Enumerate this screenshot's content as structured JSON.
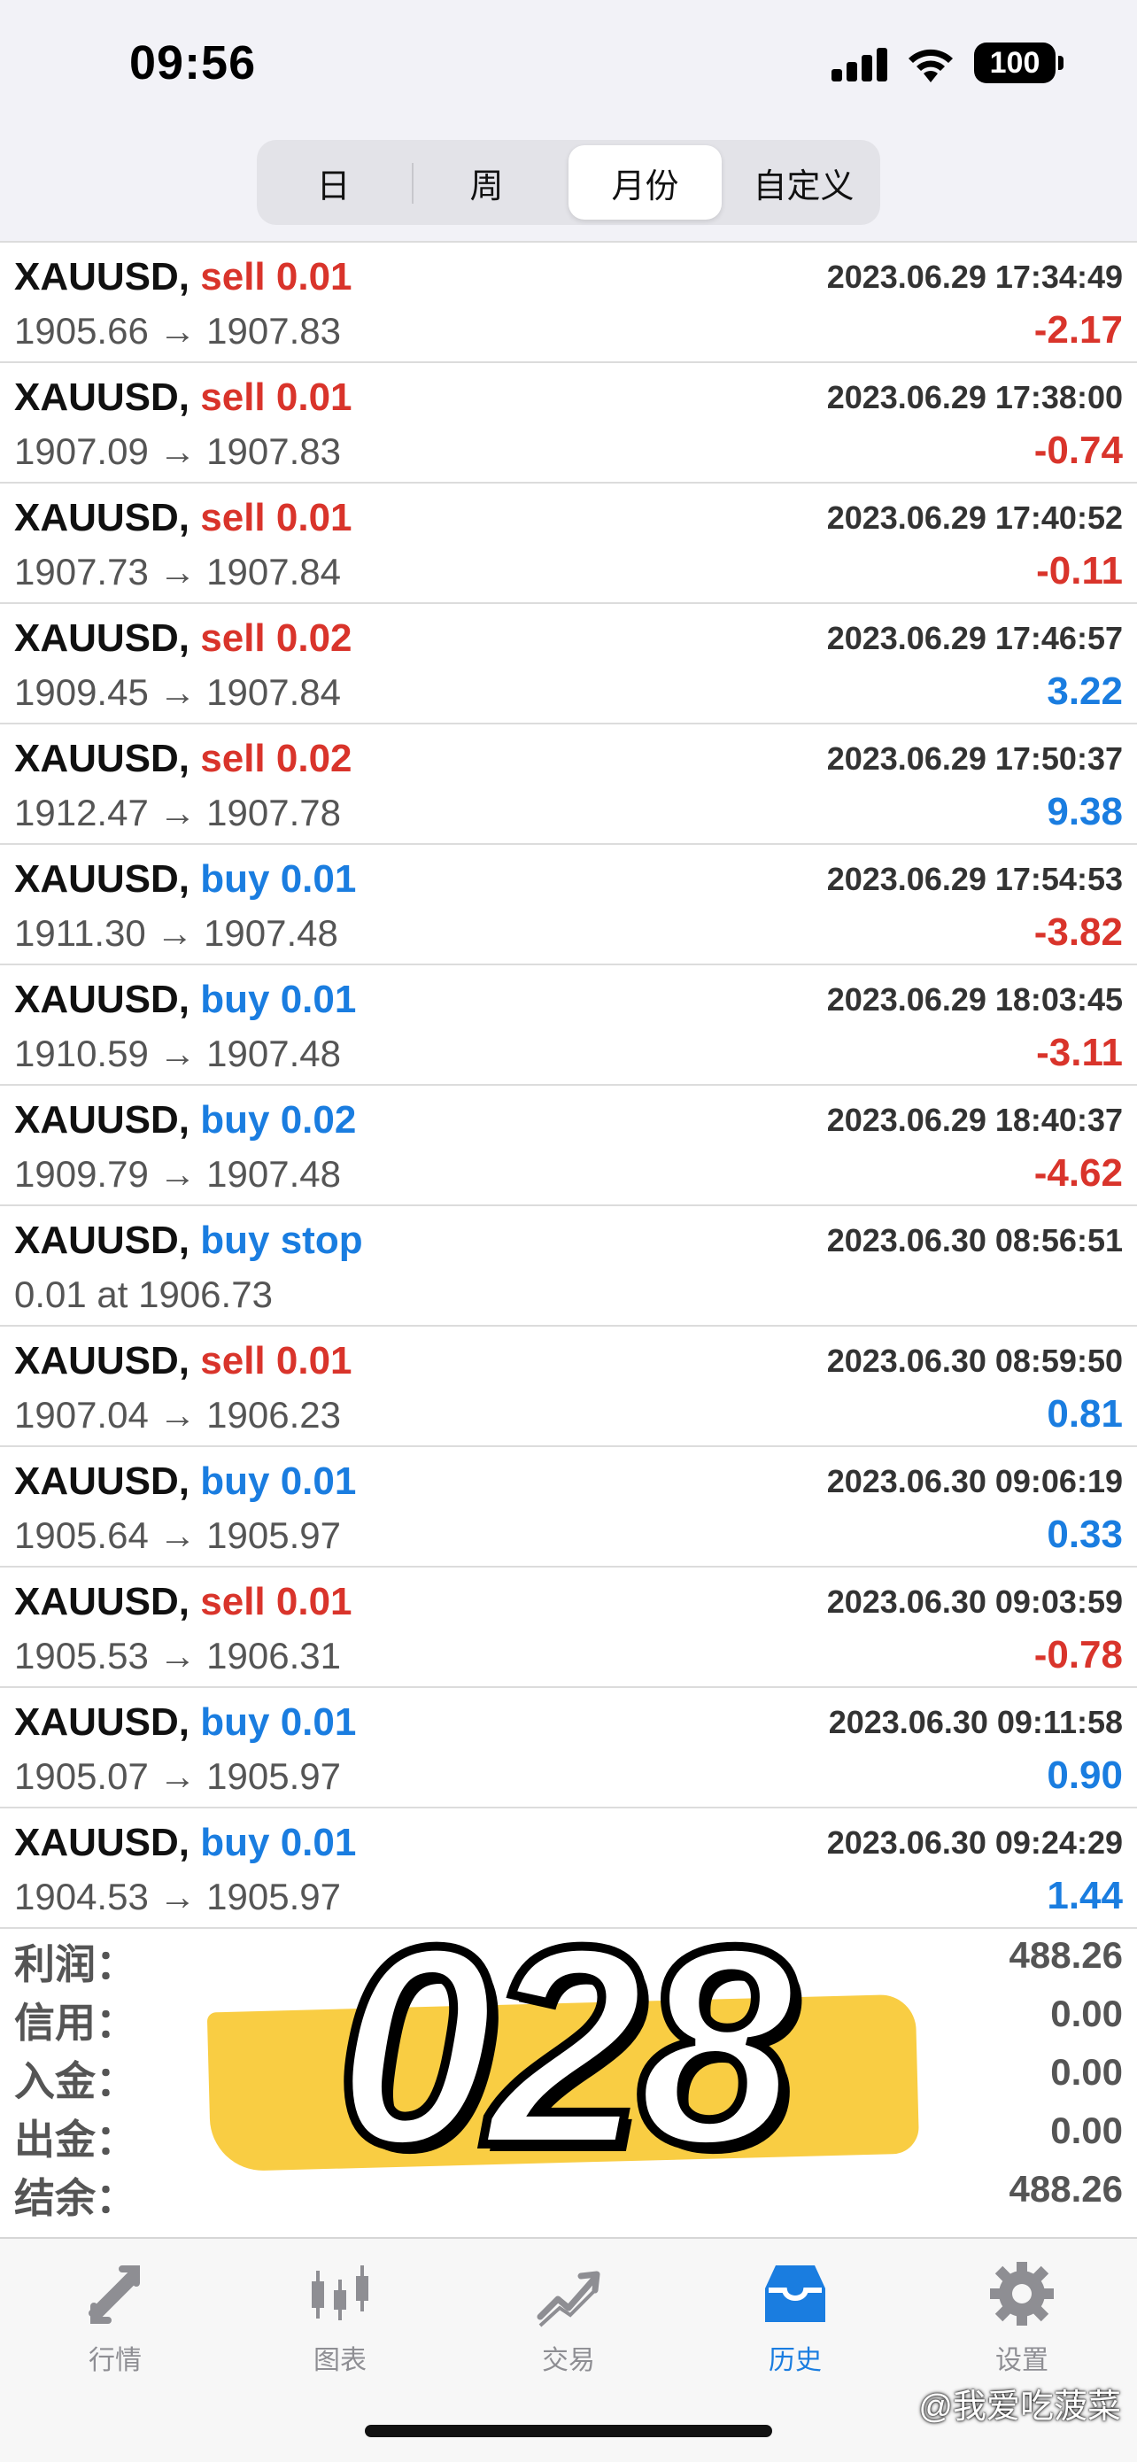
{
  "status_bar": {
    "time": "09:56",
    "battery": "100"
  },
  "segments": [
    {
      "label": "日",
      "active": false
    },
    {
      "label": "周",
      "active": false
    },
    {
      "label": "月份",
      "active": true
    },
    {
      "label": "自定义",
      "active": false
    }
  ],
  "trades": [
    {
      "symbol": "XAUUSD,",
      "side": "sell",
      "side_text": "sell 0.01",
      "time": "2023.06.29 17:34:49",
      "prices": "1905.66 → 1907.83",
      "profit": "-2.17"
    },
    {
      "symbol": "XAUUSD,",
      "side": "sell",
      "side_text": "sell 0.01",
      "time": "2023.06.29 17:38:00",
      "prices": "1907.09 → 1907.83",
      "profit": "-0.74"
    },
    {
      "symbol": "XAUUSD,",
      "side": "sell",
      "side_text": "sell 0.01",
      "time": "2023.06.29 17:40:52",
      "prices": "1907.73 → 1907.84",
      "profit": "-0.11"
    },
    {
      "symbol": "XAUUSD,",
      "side": "sell",
      "side_text": "sell 0.02",
      "time": "2023.06.29 17:46:57",
      "prices": "1909.45 → 1907.84",
      "profit": "3.22"
    },
    {
      "symbol": "XAUUSD,",
      "side": "sell",
      "side_text": "sell 0.02",
      "time": "2023.06.29 17:50:37",
      "prices": "1912.47 → 1907.78",
      "profit": "9.38"
    },
    {
      "symbol": "XAUUSD,",
      "side": "buy",
      "side_text": "buy 0.01",
      "time": "2023.06.29 17:54:53",
      "prices": "1911.30 → 1907.48",
      "profit": "-3.82"
    },
    {
      "symbol": "XAUUSD,",
      "side": "buy",
      "side_text": "buy 0.01",
      "time": "2023.06.29 18:03:45",
      "prices": "1910.59 → 1907.48",
      "profit": "-3.11"
    },
    {
      "symbol": "XAUUSD,",
      "side": "buy",
      "side_text": "buy 0.02",
      "time": "2023.06.29 18:40:37",
      "prices": "1909.79 → 1907.48",
      "profit": "-4.62"
    },
    {
      "symbol": "XAUUSD,",
      "side": "buy",
      "side_text": "buy stop",
      "time": "2023.06.30 08:56:51",
      "prices": "0.01 at 1906.73",
      "profit": ""
    },
    {
      "symbol": "XAUUSD,",
      "side": "sell",
      "side_text": "sell 0.01",
      "time": "2023.06.30 08:59:50",
      "prices": "1907.04 → 1906.23",
      "profit": "0.81"
    },
    {
      "symbol": "XAUUSD,",
      "side": "buy",
      "side_text": "buy 0.01",
      "time": "2023.06.30 09:06:19",
      "prices": "1905.64 → 1905.97",
      "profit": "0.33"
    },
    {
      "symbol": "XAUUSD,",
      "side": "sell",
      "side_text": "sell 0.01",
      "time": "2023.06.30 09:03:59",
      "prices": "1905.53 → 1906.31",
      "profit": "-0.78"
    },
    {
      "symbol": "XAUUSD,",
      "side": "buy",
      "side_text": "buy 0.01",
      "time": "2023.06.30 09:11:58",
      "prices": "1905.07 → 1905.97",
      "profit": "0.90"
    },
    {
      "symbol": "XAUUSD,",
      "side": "buy",
      "side_text": "buy 0.01",
      "time": "2023.06.30 09:24:29",
      "prices": "1904.53 → 1905.97",
      "profit": "1.44"
    }
  ],
  "summary": [
    {
      "label": "利润：",
      "value": "488.26"
    },
    {
      "label": "信用：",
      "value": "0.00"
    },
    {
      "label": "入金：",
      "value": "0.00"
    },
    {
      "label": "出金：",
      "value": "0.00"
    },
    {
      "label": "结余：",
      "value": "488.26"
    }
  ],
  "overlay": {
    "number": "028",
    "accent": "#f9c933"
  },
  "tabs": [
    {
      "label": "行情",
      "icon": "quotes-icon",
      "active": false
    },
    {
      "label": "图表",
      "icon": "chart-icon",
      "active": false
    },
    {
      "label": "交易",
      "icon": "trade-icon",
      "active": false
    },
    {
      "label": "历史",
      "icon": "history-icon",
      "active": true
    },
    {
      "label": "设置",
      "icon": "gear-icon",
      "active": false
    }
  ],
  "watermark": "@我爱吃菠菜",
  "colors": {
    "sell": "#d9342b",
    "buy": "#1a7de0",
    "active_tab": "#1a7de0",
    "inactive_tab": "#8e8e93"
  }
}
